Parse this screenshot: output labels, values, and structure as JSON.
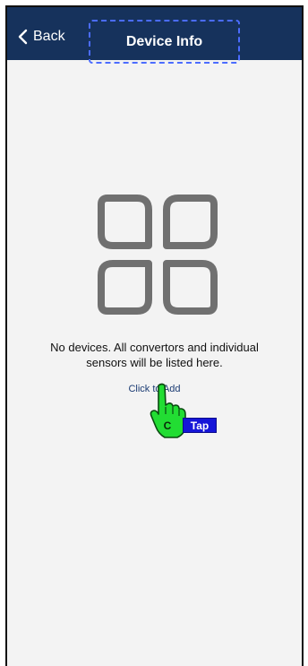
{
  "navbar": {
    "back_label": "Back",
    "title": "Device Info"
  },
  "empty_state": {
    "icon": "grid-icon",
    "line1": "No devices. All convertors and individual",
    "line2": "sensors will be listed here."
  },
  "add_link": "Click to Add",
  "tap_hint": {
    "cursor_letter": "C",
    "badge": "Tap"
  },
  "colors": {
    "navbar_bg": "#16325c",
    "background": "#f3f3f3",
    "link": "#1b3b73",
    "icon_gray": "#707070",
    "tap_badge": "#1515d8",
    "cursor_green": "#22dd33"
  }
}
